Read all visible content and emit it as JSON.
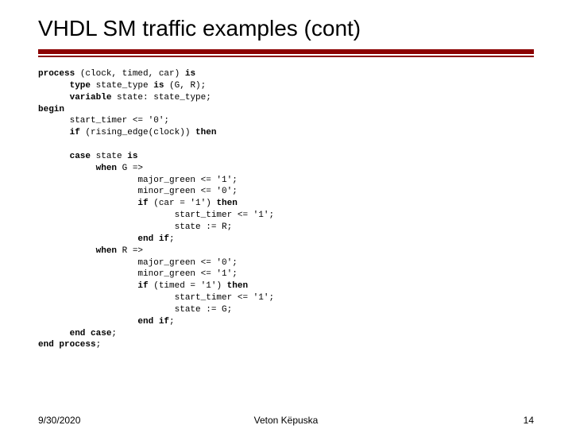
{
  "title": "VHDL SM traffic examples (cont)",
  "code": {
    "l1a": "process",
    "l1b": " (clock, timed, car) ",
    "l1c": "is",
    "l2a": "      type",
    "l2b": " state_type ",
    "l2c": "is",
    "l2d": " (G, R);",
    "l3a": "      variable",
    "l3b": " state: state_type;",
    "l4a": "begin",
    "l5": "      start_timer <= '0';",
    "l6a": "      if",
    "l6b": " (rising_edge(clock)) ",
    "l6c": "then",
    "l7a": "      case",
    "l7b": " state ",
    "l7c": "is",
    "l8a": "           when",
    "l8b": " G =>",
    "l9": "                   major_green <= '1';",
    "l10": "                   minor_green <= '0';",
    "l11a": "                   if",
    "l11b": " (car = '1') ",
    "l11c": "then",
    "l12": "                          start_timer <= '1';",
    "l13": "                          state := R;",
    "l14a": "                   end if",
    "l14b": ";",
    "l15a": "           when",
    "l15b": " R =>",
    "l16": "                   major_green <= '0';",
    "l17": "                   minor_green <= '1';",
    "l18a": "                   if",
    "l18b": " (timed = '1') ",
    "l18c": "then",
    "l19": "                          start_timer <= '1';",
    "l20": "                          state := G;",
    "l21a": "                   end if",
    "l21b": ";",
    "l22a": "      end case",
    "l22b": ";",
    "l23a": "end process",
    "l23b": ";"
  },
  "footer": {
    "date": "9/30/2020",
    "author": "Veton Këpuska",
    "page": "14"
  }
}
